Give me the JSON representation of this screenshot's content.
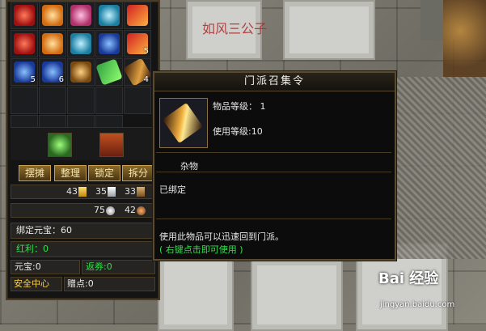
{
  "watermark": "如风三公子",
  "inventory": {
    "rows": [
      [
        {
          "icon": "red-crystal-icon",
          "count": ""
        },
        {
          "icon": "orange-orb-icon",
          "count": ""
        },
        {
          "icon": "rosy-pearls-icon",
          "count": ""
        },
        {
          "icon": "cyan-gems-icon",
          "count": ""
        },
        {
          "icon": "red-gem-icon",
          "count": ""
        }
      ],
      [
        {
          "icon": "red-flower-icon",
          "count": ""
        },
        {
          "icon": "orange-pearls-icon",
          "count": ""
        },
        {
          "icon": "cyan-orb-icon",
          "count": ""
        },
        {
          "icon": "blue-pearls-icon",
          "count": ""
        },
        {
          "icon": "red-blade-icon",
          "count": "5"
        }
      ],
      [
        {
          "icon": "blue-flame-icon",
          "count": "5"
        },
        {
          "icon": "blue-orb-icon",
          "count": "6"
        },
        {
          "icon": "gold-pot-icon",
          "count": ""
        },
        {
          "icon": "green-talisman-icon",
          "count": ""
        },
        {
          "icon": "coffin-token-icon",
          "count": "4"
        }
      ],
      [
        {
          "icon": "",
          "count": ""
        },
        {
          "icon": "",
          "count": ""
        },
        {
          "icon": "",
          "count": ""
        },
        {
          "icon": "",
          "count": ""
        },
        {
          "icon": "",
          "count": ""
        }
      ],
      [
        {
          "icon": "",
          "count": ""
        },
        {
          "icon": "",
          "count": ""
        },
        {
          "icon": "",
          "count": ""
        },
        {
          "icon": "",
          "count": ""
        }
      ]
    ],
    "mid_icons": [
      "money-bag-icon",
      "treasure-chest-icon"
    ],
    "buttons": {
      "stall": "摆摊",
      "sort": "整理",
      "lock": "锁定",
      "split": "拆分"
    },
    "currency_row1": {
      "gold": "43",
      "silver": "35",
      "book": "33"
    },
    "currency_row2": {
      "silver_coin": "75",
      "copper_coin": "42"
    },
    "bound_yuanbao": "绑定元宝：60",
    "bonus": "红利：0",
    "yuanbao": "元宝:0",
    "rebate": "返券:0",
    "safety_center": "安全中心",
    "gift_points": "赠点:0"
  },
  "tooltip": {
    "title": "门派召集令",
    "item_level": "物品等级： 1",
    "use_level": "使用等级:10",
    "category": "杂物",
    "bound": "已绑定",
    "description": "使用此物品可以迅速回到门派。",
    "hint": "( 右键点击即可使用 )"
  },
  "baidu": {
    "logo": "Bai 经验",
    "url": "jingyan.baidu.com"
  }
}
